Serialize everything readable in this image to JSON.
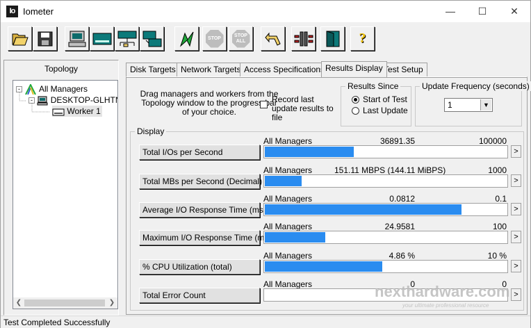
{
  "window": {
    "title": "Iometer",
    "app_icon_text": "Io"
  },
  "toolbar": {
    "buttons": [
      {
        "name": "open-config-icon"
      },
      {
        "name": "save-config-icon"
      },
      {
        "name": "start-display-manager-icon"
      },
      {
        "name": "new-disk-worker-icon"
      },
      {
        "name": "new-network-worker-icon"
      },
      {
        "name": "duplicate-worker-icon"
      },
      {
        "name": "start-tests-icon"
      },
      {
        "name": "stop-icon",
        "text": "STOP"
      },
      {
        "name": "stop-all-icon",
        "text": "STOP ALL"
      },
      {
        "name": "reset-workers-icon"
      },
      {
        "name": "exit-icon"
      },
      {
        "name": "exit-door-icon"
      },
      {
        "name": "help-icon",
        "text": "?"
      }
    ]
  },
  "topology": {
    "header": "Topology",
    "items": [
      "All Managers",
      "DESKTOP-GLHTN",
      "Worker 1"
    ]
  },
  "tabs": [
    "Disk Targets",
    "Network Targets",
    "Access Specifications",
    "Results Display",
    "Test Setup"
  ],
  "active_tab": "Results Display",
  "results": {
    "drag_text": "Drag managers and workers from the Topology window to the progress bar of your choice.",
    "record_label": "Record last update results to file",
    "results_since": {
      "title": "Results Since",
      "options": [
        "Start of Test",
        "Last Update"
      ],
      "selected": "Start of Test"
    },
    "update_frequency": {
      "title": "Update Frequency (seconds)",
      "value": "1"
    },
    "display_title": "Display",
    "metrics": [
      {
        "label": "Total I/Os per Second",
        "source": "All Managers",
        "value": "36891.35",
        "max": "100000",
        "fill": 0.369
      },
      {
        "label": "Total MBs per Second (Decimal)",
        "source": "All Managers",
        "value": "151.11 MBPS (144.11 MiBPS)",
        "max": "1000",
        "fill": 0.151
      },
      {
        "label": "Average I/O Response Time (ms)",
        "source": "All Managers",
        "value": "0.0812",
        "max": "0.1",
        "fill": 0.812
      },
      {
        "label": "Maximum I/O Response Time (ms)",
        "source": "All Managers",
        "value": "24.9581",
        "max": "100",
        "fill": 0.25
      },
      {
        "label": "% CPU Utilization (total)",
        "source": "All Managers",
        "value": "4.86 %",
        "max": "10 %",
        "fill": 0.486
      },
      {
        "label": "Total Error Count",
        "source": "All Managers",
        "value": "0",
        "max": "0",
        "fill": 0
      }
    ]
  },
  "status": {
    "text": "Test Completed Successfully"
  },
  "watermark": {
    "main": "nexthardware.com",
    "sub": "your ultimate professional resource"
  },
  "colors": {
    "bar_fill": "#2a8cf0",
    "window_bg": "#f0f0f0"
  }
}
